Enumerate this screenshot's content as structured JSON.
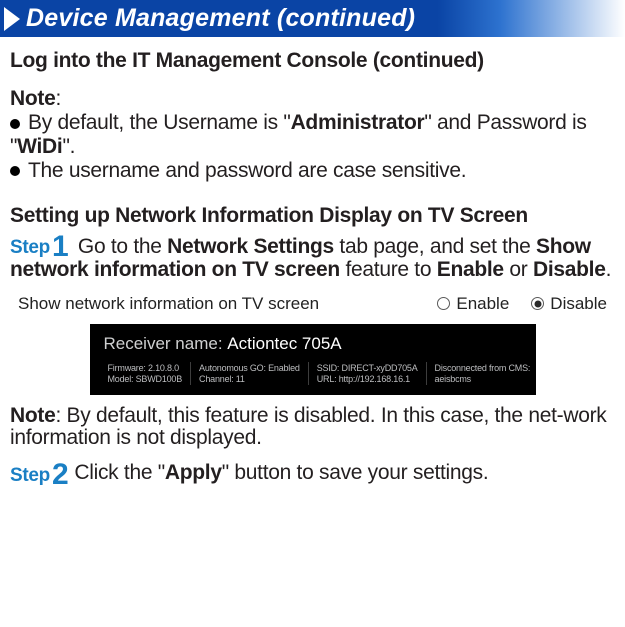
{
  "header": {
    "title": "Device Management (continued)"
  },
  "section1": {
    "title": "Log into the IT Management Console (continued)",
    "note_label": "Note",
    "bullet1_pre": "By default, the Username is \"",
    "bullet1_user": "Administrator",
    "bullet1_mid": "\" and Password is \"",
    "bullet1_pass": "WiDi",
    "bullet1_post": "\".",
    "bullet2": "The username and password are case sensitive."
  },
  "section2": {
    "heading": "Setting up Network Information Display on TV Screen",
    "step1_label": "Step",
    "step1_num": "1",
    "s1_p1": "Go to the ",
    "s1_b1": "Network Settings",
    "s1_p2": " tab page, and set the ",
    "s1_b2": "Show network information on TV screen",
    "s1_p3": " feature to ",
    "s1_b3": "Enable",
    "s1_p4": " or ",
    "s1_b4": "Disable",
    "s1_p5": "."
  },
  "radio": {
    "label": "Show network information on TV screen",
    "enable": "Enable",
    "disable": "Disable"
  },
  "tv_panel": {
    "title_prefix": "Receiver name:  ",
    "receiver_name": "Actiontec 705A",
    "col1_a": "Firmware:  2.10.8.0",
    "col1_b": "Model:  SBWD100B",
    "col2_a": "Autonomous GO: Enabled",
    "col2_b": "Channel: 11",
    "col3_a": "SSID: DIRECT-xyDD705A",
    "col3_b": "URL: http://192.168.16.1",
    "col4_a": "Disconnected from CMS:",
    "col4_b": "aeisbcms"
  },
  "note2": {
    "label": "Note",
    "text": ": By default, this feature is disabled. In this case, the net-work information is not displayed."
  },
  "step2": {
    "label": "Step",
    "num": "2",
    "p1": "Click the \"",
    "b1": "Apply",
    "p2": "\" button to save your settings."
  }
}
